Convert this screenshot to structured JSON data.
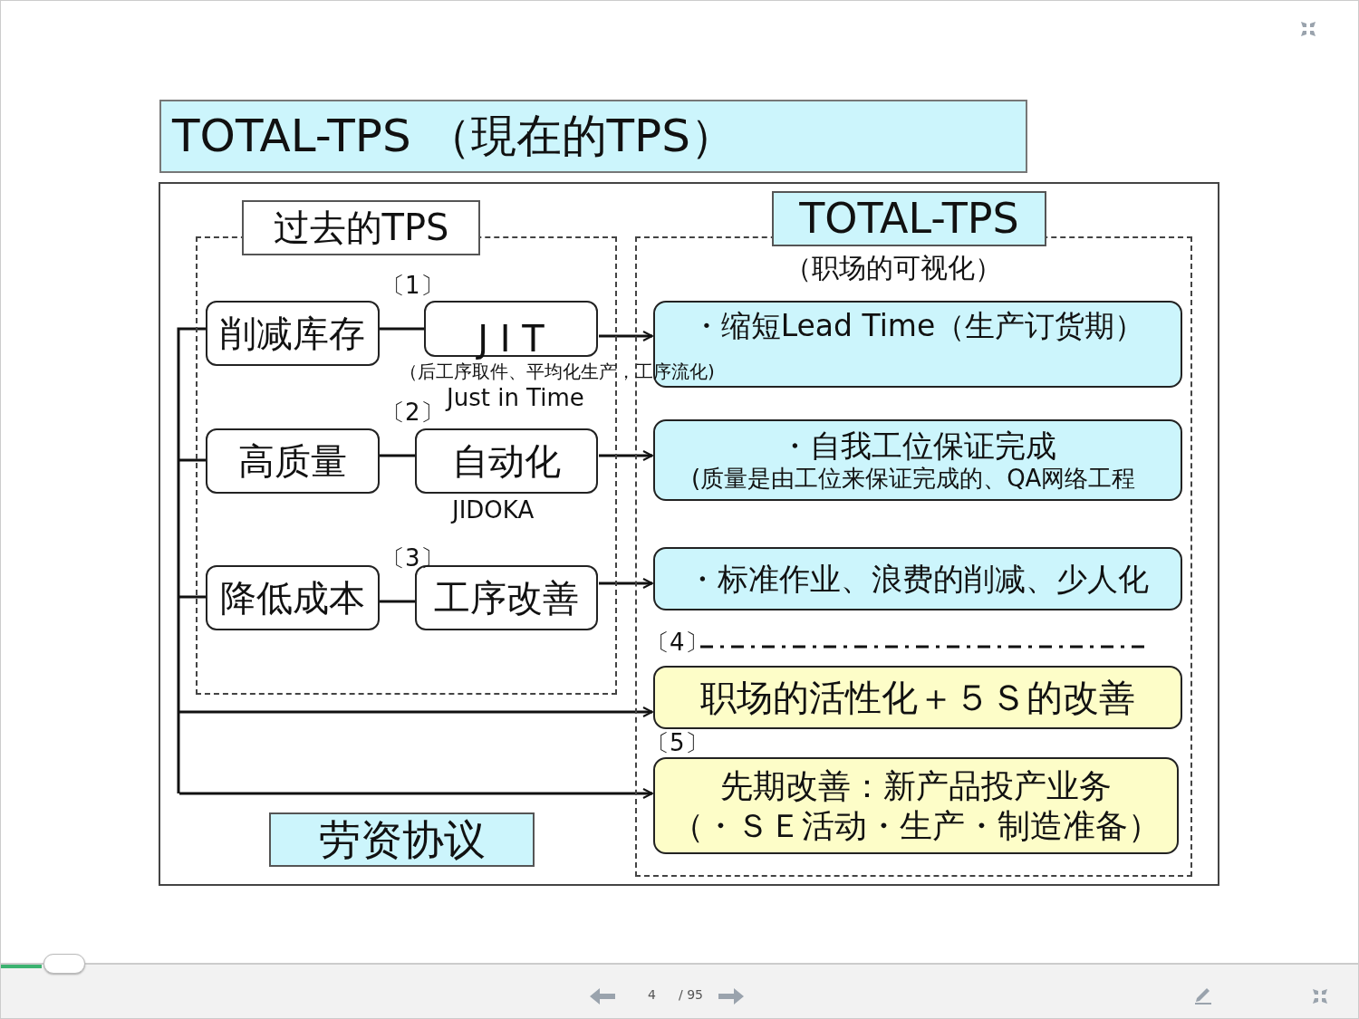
{
  "slide": {
    "title": "TOTAL-TPS （現在的TPS）",
    "past_label": "过去的TPS",
    "total_label": "TOTAL-TPS",
    "total_subtitle": "（职场的可视化）",
    "goals": [
      {
        "text": "削减库存"
      },
      {
        "text": "高质量"
      },
      {
        "text": "降低成本"
      }
    ],
    "methods": [
      {
        "number": "〔1〕",
        "text": "J I T",
        "caption": "Just in Time"
      },
      {
        "number": "〔2〕",
        "text": "自动化",
        "caption": "JIDOKA"
      },
      {
        "number": "〔3〕",
        "text": "工序改善"
      }
    ],
    "jit_note": "（后工序取件、平均化生产，工序流化)",
    "results": [
      {
        "color": "#ccf5fc",
        "lines": [
          "・缩短Lead Time（生产订货期）"
        ]
      },
      {
        "color": "#ccf5fc",
        "lines": [
          "・自我工位保证完成",
          "(质量是由工位来保证完成的、QA网络工程"
        ]
      },
      {
        "color": "#ccf5fc",
        "lines": [
          "・标准作业、浪费的削减、少人化"
        ]
      },
      {
        "color": "#fdfdc8",
        "number": "〔4〕",
        "lines": [
          "职场的活性化＋５Ｓ的改善"
        ]
      },
      {
        "color": "#fdfdc8",
        "number": "〔5〕",
        "lines": [
          "先期改善：新产品投产业务",
          "（・ＳＥ活动・生产・制造准备）"
        ]
      }
    ],
    "agreement": "劳资协议"
  },
  "viewer": {
    "progress": {
      "level": 0.03
    },
    "page": "4",
    "total": "/ 95"
  }
}
